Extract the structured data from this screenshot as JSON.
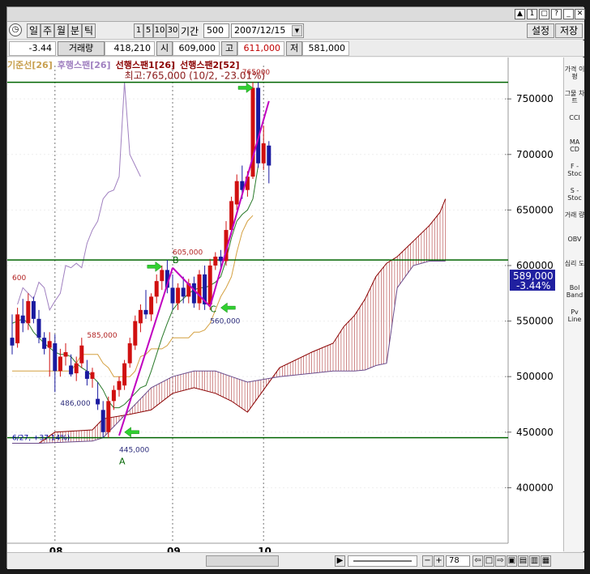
{
  "toolbar": {
    "periods": [
      "일",
      "주",
      "월",
      "분",
      "틱"
    ],
    "num_buttons": [
      "1",
      "5",
      "10",
      "30"
    ],
    "period_label": "기간",
    "period_value": "500",
    "date_value": "2007/12/15",
    "settings_label": "설정",
    "save_label": "저장"
  },
  "quote": {
    "change": "-3.44",
    "volume_label": "거래량",
    "volume_value": "418,210",
    "open_label": "시",
    "open_value": "609,000",
    "high_label": "고",
    "high_value": "611,000",
    "low_label": "저",
    "low_value": "581,000"
  },
  "legend": [
    {
      "text": "기준선[26]",
      "color": "#c8a050"
    },
    {
      "text": "후행스팬[26]",
      "color": "#a080c0"
    },
    {
      "text": "선행스팬1[26]",
      "color": "#8b0000"
    },
    {
      "text": "선행스팬2[52]",
      "color": "#8b0000"
    }
  ],
  "right_panel": [
    {
      "label": "가격 이평"
    },
    {
      "label": "그물 차트"
    },
    {
      "label": "CCI"
    },
    {
      "label": "MA CD"
    },
    {
      "label": "F - Stoc"
    },
    {
      "label": "S - Stoc"
    },
    {
      "label": "거래 량"
    },
    {
      "label": "OBV"
    },
    {
      "label": "심리 도"
    },
    {
      "label": "Bol Band"
    },
    {
      "label": "Pv Line"
    }
  ],
  "status": {
    "zoom": "78"
  },
  "chart_data": {
    "type": "candlestick",
    "ylim": [
      350000,
      780000
    ],
    "y_ticks": [
      400000,
      450000,
      500000,
      550000,
      600000,
      650000,
      700000,
      750000
    ],
    "y_tick_labels": [
      "400000",
      "450000",
      "500000",
      "550000",
      "600000",
      "650000",
      "700000",
      "750000"
    ],
    "x_tick_labels": [
      {
        "label": "08",
        "index": 8
      },
      {
        "label": "09",
        "index": 30
      },
      {
        "label": "10",
        "index": 47
      }
    ],
    "n_slots": 82,
    "current_price": {
      "value": 589000,
      "label": "589,000",
      "change": "-3.44%"
    },
    "annotations": [
      {
        "text": "최고:765,000 (10/2, -23.01%)",
        "index": 21,
        "value": 768000,
        "color": "#8b1a1a"
      },
      {
        "text": "6/27, +37.14%)",
        "index": 0,
        "value": 443000,
        "color": "#0000a0"
      },
      {
        "text": "605,000",
        "index": 30,
        "value": 610000,
        "color": "#b22222"
      },
      {
        "text": "585,000",
        "index": 14,
        "value": 535000,
        "color": "#b22222"
      },
      {
        "text": "560,000",
        "index": 37,
        "value": 548000,
        "color": "#2a2a7a"
      },
      {
        "text": "486,000",
        "index": 9,
        "value": 474000,
        "color": "#2a2a7a"
      },
      {
        "text": "445,000",
        "index": 20,
        "value": 432000,
        "color": "#2a2a7a"
      },
      {
        "text": "600",
        "index": 0,
        "value": 587000,
        "color": "#b22222"
      },
      {
        "text": "765000",
        "index": 43,
        "value": 772000,
        "color": "#b22222"
      },
      {
        "text": "A",
        "index": 20,
        "value": 421000,
        "color": "#006400"
      },
      {
        "text": "B",
        "index": 30,
        "value": 602000,
        "color": "#006400"
      },
      {
        "text": "C",
        "index": 37,
        "value": 558000,
        "color": "#006400"
      }
    ],
    "hlines": [
      {
        "value": 765000,
        "color": "#006400"
      },
      {
        "value": 605000,
        "color": "#006400"
      },
      {
        "value": 445000,
        "color": "#006400"
      }
    ],
    "trendlines": [
      {
        "from": [
          20,
          447000
        ],
        "to": [
          30,
          598000
        ],
        "color": "#c000c0"
      },
      {
        "from": [
          30,
          598000
        ],
        "to": [
          37,
          563000
        ],
        "color": "#c000c0"
      },
      {
        "from": [
          37,
          563000
        ],
        "to": [
          48,
          748000
        ],
        "color": "#c000c0"
      }
    ],
    "arrows": [
      {
        "index": 21,
        "value": 450000,
        "dir": "left"
      },
      {
        "index": 28,
        "value": 599000,
        "dir": "right"
      },
      {
        "index": 39,
        "value": 562000,
        "dir": "left"
      },
      {
        "index": 45,
        "value": 760000,
        "dir": "right"
      }
    ],
    "candles": [
      {
        "o": 535000,
        "h": 556000,
        "l": 520000,
        "c": 528000
      },
      {
        "o": 530000,
        "h": 562000,
        "l": 526000,
        "c": 556000
      },
      {
        "o": 555000,
        "h": 570000,
        "l": 540000,
        "c": 548000
      },
      {
        "o": 548000,
        "h": 575000,
        "l": 542000,
        "c": 568000
      },
      {
        "o": 568000,
        "h": 572000,
        "l": 548000,
        "c": 552000
      },
      {
        "o": 552000,
        "h": 560000,
        "l": 530000,
        "c": 535000
      },
      {
        "o": 535000,
        "h": 540000,
        "l": 520000,
        "c": 525000
      },
      {
        "o": 526000,
        "h": 540000,
        "l": 500000,
        "c": 532000
      },
      {
        "o": 530000,
        "h": 538000,
        "l": 486000,
        "c": 505000
      },
      {
        "o": 505000,
        "h": 525000,
        "l": 500000,
        "c": 518000
      },
      {
        "o": 518000,
        "h": 530000,
        "l": 510000,
        "c": 522000
      },
      {
        "o": 510000,
        "h": 520000,
        "l": 500000,
        "c": 502000
      },
      {
        "o": 503000,
        "h": 518000,
        "l": 496000,
        "c": 512000
      },
      {
        "o": 512000,
        "h": 535000,
        "l": 508000,
        "c": 528000
      },
      {
        "o": 505000,
        "h": 515000,
        "l": 492000,
        "c": 498000
      },
      {
        "o": 498000,
        "h": 508000,
        "l": 490000,
        "c": 504000
      },
      {
        "o": 480000,
        "h": 495000,
        "l": 470000,
        "c": 475000
      },
      {
        "o": 470000,
        "h": 478000,
        "l": 445000,
        "c": 450000
      },
      {
        "o": 450000,
        "h": 482000,
        "l": 445000,
        "c": 478000
      },
      {
        "o": 478000,
        "h": 492000,
        "l": 470000,
        "c": 488000
      },
      {
        "o": 488000,
        "h": 500000,
        "l": 482000,
        "c": 496000
      },
      {
        "o": 492000,
        "h": 515000,
        "l": 488000,
        "c": 512000
      },
      {
        "o": 512000,
        "h": 535000,
        "l": 508000,
        "c": 530000
      },
      {
        "o": 528000,
        "h": 555000,
        "l": 524000,
        "c": 550000
      },
      {
        "o": 548000,
        "h": 565000,
        "l": 540000,
        "c": 560000
      },
      {
        "o": 560000,
        "h": 578000,
        "l": 552000,
        "c": 556000
      },
      {
        "o": 556000,
        "h": 575000,
        "l": 550000,
        "c": 572000
      },
      {
        "o": 572000,
        "h": 592000,
        "l": 566000,
        "c": 586000
      },
      {
        "o": 586000,
        "h": 600000,
        "l": 578000,
        "c": 596000
      },
      {
        "o": 596000,
        "h": 605000,
        "l": 575000,
        "c": 580000
      },
      {
        "o": 580000,
        "h": 592000,
        "l": 560000,
        "c": 566000
      },
      {
        "o": 566000,
        "h": 584000,
        "l": 560000,
        "c": 580000
      },
      {
        "o": 580000,
        "h": 590000,
        "l": 566000,
        "c": 572000
      },
      {
        "o": 572000,
        "h": 588000,
        "l": 566000,
        "c": 584000
      },
      {
        "o": 584000,
        "h": 590000,
        "l": 562000,
        "c": 566000
      },
      {
        "o": 566000,
        "h": 596000,
        "l": 560000,
        "c": 592000
      },
      {
        "o": 592000,
        "h": 600000,
        "l": 560000,
        "c": 565000
      },
      {
        "o": 565000,
        "h": 606000,
        "l": 560000,
        "c": 600000
      },
      {
        "o": 600000,
        "h": 612000,
        "l": 596000,
        "c": 608000
      },
      {
        "o": 608000,
        "h": 614000,
        "l": 598000,
        "c": 604000
      },
      {
        "o": 604000,
        "h": 640000,
        "l": 600000,
        "c": 632000
      },
      {
        "o": 632000,
        "h": 662000,
        "l": 628000,
        "c": 658000
      },
      {
        "o": 655000,
        "h": 682000,
        "l": 650000,
        "c": 676000
      },
      {
        "o": 676000,
        "h": 690000,
        "l": 660000,
        "c": 668000
      },
      {
        "o": 668000,
        "h": 685000,
        "l": 662000,
        "c": 680000
      },
      {
        "o": 680000,
        "h": 765000,
        "l": 678000,
        "c": 760000
      },
      {
        "o": 760000,
        "h": 765000,
        "l": 688000,
        "c": 692000
      },
      {
        "o": 692000,
        "h": 726000,
        "l": 686000,
        "c": 710000
      },
      {
        "o": 708000,
        "h": 712000,
        "l": 674000,
        "c": 690000
      }
    ],
    "kijun": [
      505000,
      505000,
      505000,
      505000,
      505000,
      505000,
      505000,
      505000,
      505000,
      505000,
      505000,
      505000,
      512000,
      520000,
      520000,
      520000,
      520000,
      512000,
      508000,
      500000,
      500000,
      500000,
      500000,
      505000,
      518000,
      520000,
      525000,
      525000,
      525000,
      528000,
      535000,
      535000,
      535000,
      535000,
      540000,
      540000,
      542000,
      548000,
      560000,
      572000,
      580000,
      590000,
      612000,
      630000,
      640000,
      645000
    ],
    "tenkan": [
      548000,
      550000,
      552000,
      548000,
      540000,
      535000,
      530000,
      526000,
      522000,
      520000,
      520000,
      518000,
      512000,
      508000,
      505000,
      500000,
      495000,
      488000,
      478000,
      472000,
      472000,
      475000,
      480000,
      485000,
      490000,
      492000,
      505000,
      520000,
      535000,
      548000,
      560000,
      566000,
      570000,
      575000,
      578000,
      580000,
      580000,
      582000,
      585000,
      590000,
      605000,
      625000,
      640000,
      646000,
      650000,
      660000,
      690000
    ],
    "chikou": [
      0,
      0,
      0,
      0,
      0,
      0,
      0,
      0,
      0,
      0,
      0,
      0,
      0,
      0,
      0,
      0,
      0,
      0,
      0,
      0,
      0,
      0,
      0,
      0,
      0,
      0,
      0,
      0,
      0,
      0,
      0,
      0,
      0,
      0,
      0,
      0,
      0,
      0,
      0,
      0,
      0,
      0,
      0,
      0,
      0,
      0,
      0
    ],
    "chikou_series": [
      [
        1,
        565000
      ],
      [
        2,
        580000
      ],
      [
        3,
        575000
      ],
      [
        4,
        570000
      ],
      [
        5,
        585000
      ],
      [
        6,
        580000
      ],
      [
        7,
        560000
      ],
      [
        8,
        568000
      ],
      [
        9,
        575000
      ],
      [
        10,
        600000
      ],
      [
        11,
        598000
      ],
      [
        12,
        602000
      ],
      [
        13,
        598000
      ],
      [
        14,
        620000
      ],
      [
        15,
        632000
      ],
      [
        16,
        640000
      ],
      [
        17,
        660000
      ],
      [
        18,
        666000
      ],
      [
        19,
        668000
      ],
      [
        20,
        680000
      ],
      [
        21,
        765000
      ],
      [
        22,
        700000
      ],
      [
        23,
        690000
      ],
      [
        24,
        680000
      ]
    ],
    "span1": [
      [
        0,
        440000
      ],
      [
        5,
        440000
      ],
      [
        8,
        450000
      ],
      [
        15,
        452000
      ],
      [
        17,
        462000
      ],
      [
        22,
        466000
      ],
      [
        26,
        470000
      ],
      [
        30,
        485000
      ],
      [
        34,
        490000
      ],
      [
        38,
        485000
      ],
      [
        41,
        478000
      ],
      [
        44,
        468000
      ],
      [
        50,
        508000
      ],
      [
        56,
        522000
      ],
      [
        60,
        530000
      ],
      [
        62,
        545000
      ],
      [
        64,
        555000
      ],
      [
        66,
        570000
      ],
      [
        68,
        590000
      ],
      [
        70,
        602000
      ],
      [
        72,
        608000
      ],
      [
        75,
        622000
      ],
      [
        78,
        636000
      ],
      [
        80,
        648000
      ],
      [
        81,
        660000
      ]
    ],
    "span2": [
      [
        0,
        440000
      ],
      [
        5,
        440000
      ],
      [
        15,
        442000
      ],
      [
        17,
        445000
      ],
      [
        26,
        490000
      ],
      [
        30,
        500000
      ],
      [
        34,
        505000
      ],
      [
        38,
        505000
      ],
      [
        41,
        500000
      ],
      [
        44,
        495000
      ],
      [
        50,
        500000
      ],
      [
        56,
        503000
      ],
      [
        60,
        505000
      ],
      [
        62,
        505000
      ],
      [
        64,
        505000
      ],
      [
        66,
        506000
      ],
      [
        68,
        510000
      ],
      [
        70,
        512000
      ],
      [
        72,
        580000
      ],
      [
        75,
        600000
      ],
      [
        78,
        604000
      ],
      [
        81,
        604000
      ]
    ]
  }
}
